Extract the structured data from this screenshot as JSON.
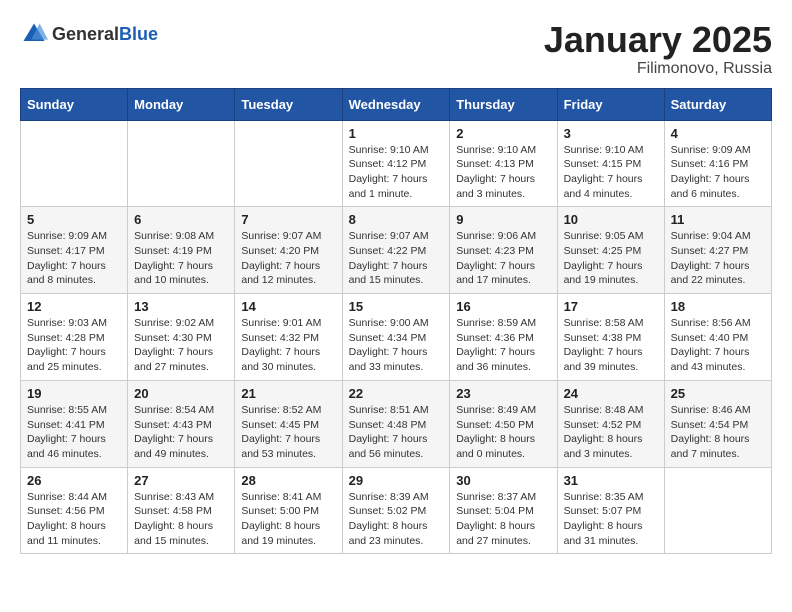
{
  "logo": {
    "general": "General",
    "blue": "Blue"
  },
  "title": "January 2025",
  "subtitle": "Filimonovo, Russia",
  "weekdays": [
    "Sunday",
    "Monday",
    "Tuesday",
    "Wednesday",
    "Thursday",
    "Friday",
    "Saturday"
  ],
  "weeks": [
    [
      {
        "day": "",
        "info": ""
      },
      {
        "day": "",
        "info": ""
      },
      {
        "day": "",
        "info": ""
      },
      {
        "day": "1",
        "info": "Sunrise: 9:10 AM\nSunset: 4:12 PM\nDaylight: 7 hours\nand 1 minute."
      },
      {
        "day": "2",
        "info": "Sunrise: 9:10 AM\nSunset: 4:13 PM\nDaylight: 7 hours\nand 3 minutes."
      },
      {
        "day": "3",
        "info": "Sunrise: 9:10 AM\nSunset: 4:15 PM\nDaylight: 7 hours\nand 4 minutes."
      },
      {
        "day": "4",
        "info": "Sunrise: 9:09 AM\nSunset: 4:16 PM\nDaylight: 7 hours\nand 6 minutes."
      }
    ],
    [
      {
        "day": "5",
        "info": "Sunrise: 9:09 AM\nSunset: 4:17 PM\nDaylight: 7 hours\nand 8 minutes."
      },
      {
        "day": "6",
        "info": "Sunrise: 9:08 AM\nSunset: 4:19 PM\nDaylight: 7 hours\nand 10 minutes."
      },
      {
        "day": "7",
        "info": "Sunrise: 9:07 AM\nSunset: 4:20 PM\nDaylight: 7 hours\nand 12 minutes."
      },
      {
        "day": "8",
        "info": "Sunrise: 9:07 AM\nSunset: 4:22 PM\nDaylight: 7 hours\nand 15 minutes."
      },
      {
        "day": "9",
        "info": "Sunrise: 9:06 AM\nSunset: 4:23 PM\nDaylight: 7 hours\nand 17 minutes."
      },
      {
        "day": "10",
        "info": "Sunrise: 9:05 AM\nSunset: 4:25 PM\nDaylight: 7 hours\nand 19 minutes."
      },
      {
        "day": "11",
        "info": "Sunrise: 9:04 AM\nSunset: 4:27 PM\nDaylight: 7 hours\nand 22 minutes."
      }
    ],
    [
      {
        "day": "12",
        "info": "Sunrise: 9:03 AM\nSunset: 4:28 PM\nDaylight: 7 hours\nand 25 minutes."
      },
      {
        "day": "13",
        "info": "Sunrise: 9:02 AM\nSunset: 4:30 PM\nDaylight: 7 hours\nand 27 minutes."
      },
      {
        "day": "14",
        "info": "Sunrise: 9:01 AM\nSunset: 4:32 PM\nDaylight: 7 hours\nand 30 minutes."
      },
      {
        "day": "15",
        "info": "Sunrise: 9:00 AM\nSunset: 4:34 PM\nDaylight: 7 hours\nand 33 minutes."
      },
      {
        "day": "16",
        "info": "Sunrise: 8:59 AM\nSunset: 4:36 PM\nDaylight: 7 hours\nand 36 minutes."
      },
      {
        "day": "17",
        "info": "Sunrise: 8:58 AM\nSunset: 4:38 PM\nDaylight: 7 hours\nand 39 minutes."
      },
      {
        "day": "18",
        "info": "Sunrise: 8:56 AM\nSunset: 4:40 PM\nDaylight: 7 hours\nand 43 minutes."
      }
    ],
    [
      {
        "day": "19",
        "info": "Sunrise: 8:55 AM\nSunset: 4:41 PM\nDaylight: 7 hours\nand 46 minutes."
      },
      {
        "day": "20",
        "info": "Sunrise: 8:54 AM\nSunset: 4:43 PM\nDaylight: 7 hours\nand 49 minutes."
      },
      {
        "day": "21",
        "info": "Sunrise: 8:52 AM\nSunset: 4:45 PM\nDaylight: 7 hours\nand 53 minutes."
      },
      {
        "day": "22",
        "info": "Sunrise: 8:51 AM\nSunset: 4:48 PM\nDaylight: 7 hours\nand 56 minutes."
      },
      {
        "day": "23",
        "info": "Sunrise: 8:49 AM\nSunset: 4:50 PM\nDaylight: 8 hours\nand 0 minutes."
      },
      {
        "day": "24",
        "info": "Sunrise: 8:48 AM\nSunset: 4:52 PM\nDaylight: 8 hours\nand 3 minutes."
      },
      {
        "day": "25",
        "info": "Sunrise: 8:46 AM\nSunset: 4:54 PM\nDaylight: 8 hours\nand 7 minutes."
      }
    ],
    [
      {
        "day": "26",
        "info": "Sunrise: 8:44 AM\nSunset: 4:56 PM\nDaylight: 8 hours\nand 11 minutes."
      },
      {
        "day": "27",
        "info": "Sunrise: 8:43 AM\nSunset: 4:58 PM\nDaylight: 8 hours\nand 15 minutes."
      },
      {
        "day": "28",
        "info": "Sunrise: 8:41 AM\nSunset: 5:00 PM\nDaylight: 8 hours\nand 19 minutes."
      },
      {
        "day": "29",
        "info": "Sunrise: 8:39 AM\nSunset: 5:02 PM\nDaylight: 8 hours\nand 23 minutes."
      },
      {
        "day": "30",
        "info": "Sunrise: 8:37 AM\nSunset: 5:04 PM\nDaylight: 8 hours\nand 27 minutes."
      },
      {
        "day": "31",
        "info": "Sunrise: 8:35 AM\nSunset: 5:07 PM\nDaylight: 8 hours\nand 31 minutes."
      },
      {
        "day": "",
        "info": ""
      }
    ]
  ]
}
